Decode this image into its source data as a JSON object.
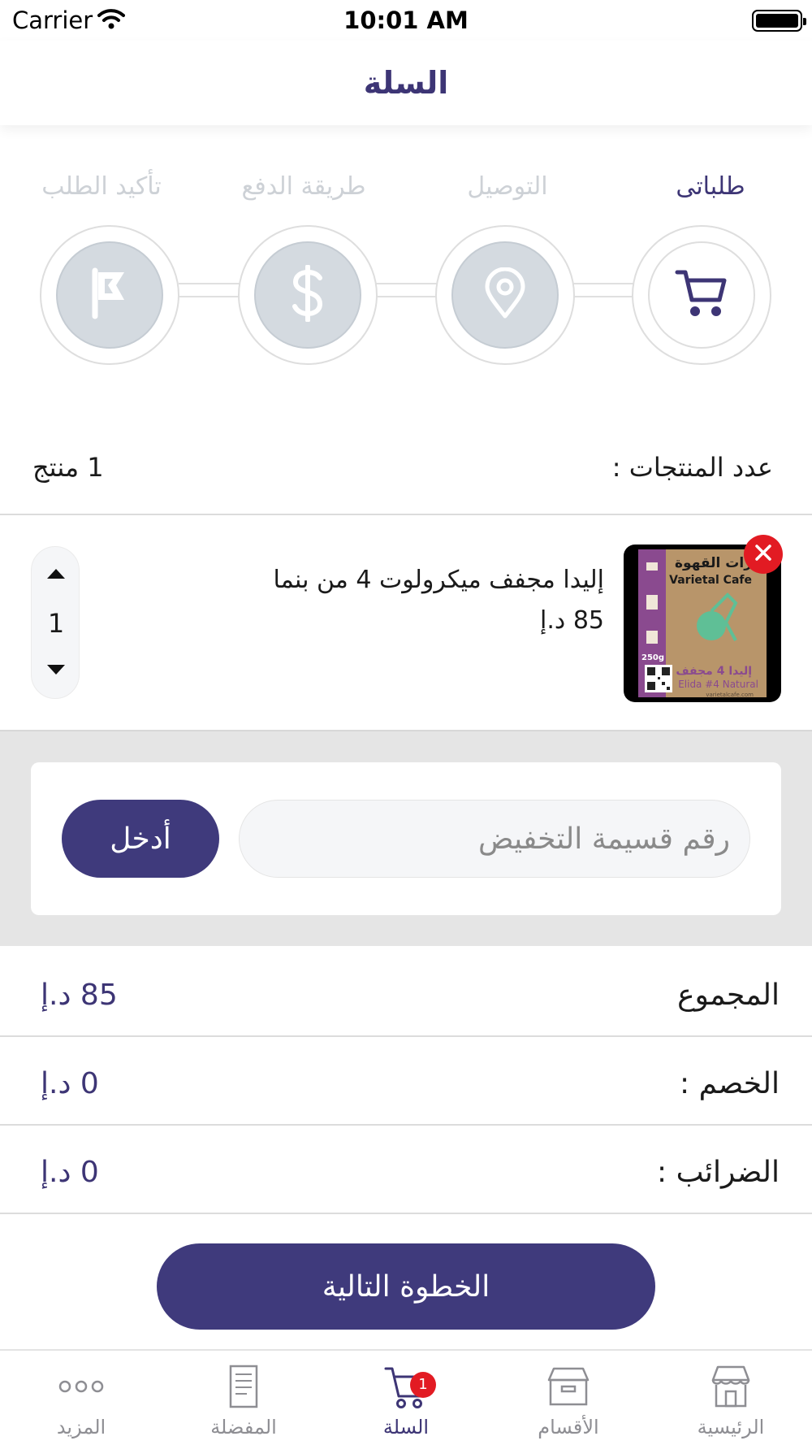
{
  "status_bar": {
    "carrier": "Carrier",
    "time": "10:01 AM"
  },
  "header": {
    "title": "السلة"
  },
  "checkout_steps": [
    {
      "label": "طلباتى",
      "icon": "cart-icon",
      "state": "active"
    },
    {
      "label": "التوصيل",
      "icon": "location-pin-icon",
      "state": "inactive"
    },
    {
      "label": "طريقة الدفع",
      "icon": "dollar-icon",
      "state": "inactive"
    },
    {
      "label": "تأكيد الطلب",
      "icon": "flag-icon",
      "state": "inactive"
    }
  ],
  "cart": {
    "count_label": "عدد المنتجات :",
    "count_value": "1  منتج",
    "items": [
      {
        "name": "إليدا مجفف ميكرولوت 4 من بنما",
        "price": "85 د.إ",
        "quantity": "1",
        "image": {
          "brand_ar": "رات القهوة",
          "brand_en": "Varietal Cafe",
          "weight": "250g",
          "product_ar": "إليدا 4 مجفف",
          "product_en": "Elida #4 Natural",
          "site": "varietalcafe.com"
        }
      }
    ]
  },
  "coupon": {
    "placeholder": "رقم قسيمة التخفيض",
    "value": "",
    "button_label": "أدخل"
  },
  "summary": {
    "subtotal_label": "المجموع",
    "subtotal_value": "85 د.إ",
    "discount_label": "الخصم :",
    "discount_value": "0 د.إ",
    "tax_label": "الضرائب :",
    "tax_value": "0 د.إ"
  },
  "next_button_label": "الخطوة التالية",
  "tab_bar": {
    "tabs": [
      {
        "label": "الرئيسية",
        "icon": "store-icon",
        "active": false
      },
      {
        "label": "الأقسام",
        "icon": "box-icon",
        "active": false
      },
      {
        "label": "السلة",
        "icon": "cart-icon",
        "active": true,
        "badge": "1"
      },
      {
        "label": "المفضلة",
        "icon": "document-icon",
        "active": false
      },
      {
        "label": "المزيد",
        "icon": "more-icon",
        "active": false
      }
    ]
  },
  "colors": {
    "primary": "#3f3a7c",
    "title": "#3d3575",
    "inactive_step": "#d4dae0",
    "badge": "#e21b23",
    "coupon_bg": "#e5e5e5"
  }
}
